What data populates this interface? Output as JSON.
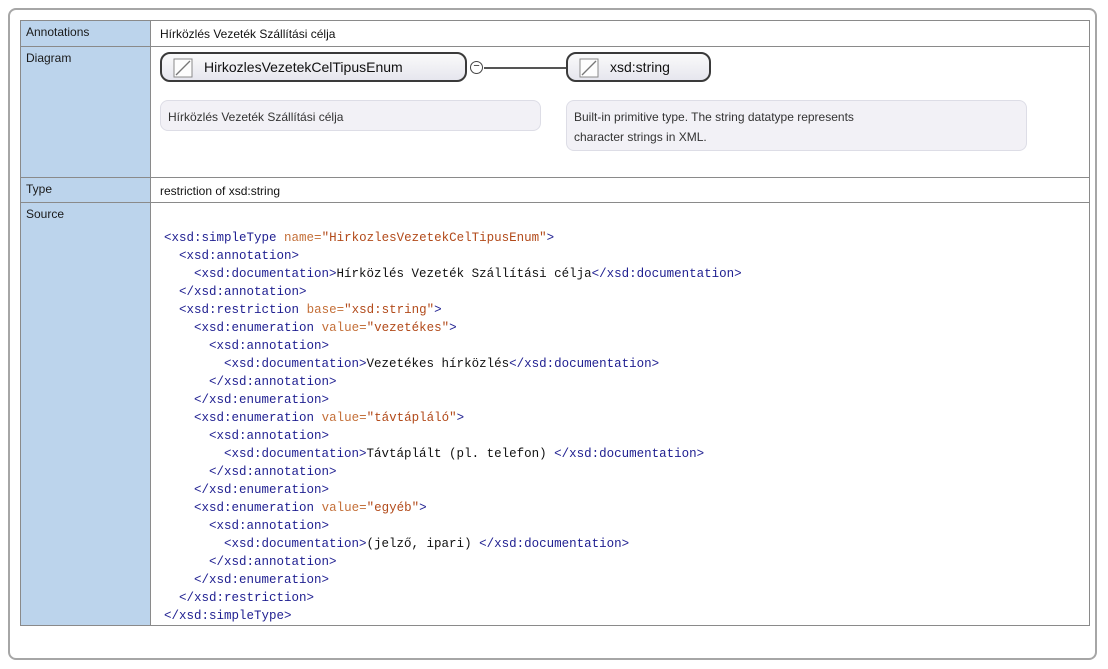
{
  "labels": {
    "annotations": "Annotations",
    "diagram": "Diagram",
    "type": "Type",
    "source": "Source"
  },
  "annotation_text": "Hírközlés Vezeték Szállítási célja",
  "diagram": {
    "main_node": "HirkozlesVezetekCelTipusEnum",
    "main_doc": "Hírközlés Vezeték Szállítási célja",
    "base_node": "xsd:string",
    "base_doc_line1": "Built-in primitive type. The string datatype represents",
    "base_doc_line2": "character strings in XML."
  },
  "type_text": "restriction of xsd:string",
  "source": {
    "simple_type_open": "<xsd:simpleType",
    "name_attr": "name=",
    "name_value": "\"HirkozlesVezetekCelTipusEnum\"",
    "gt": ">",
    "annotation_open": "<xsd:annotation>",
    "annotation_close": "</xsd:annotation>",
    "documentation_open": "<xsd:documentation>",
    "documentation_close": "</xsd:documentation>",
    "main_doc": "Hírközlés Vezeték Szállítási célja",
    "restriction_open": "<xsd:restriction",
    "base_attr": "base=",
    "base_value": "\"xsd:string\"",
    "restriction_close": "</xsd:restriction>",
    "enumeration_open": "<xsd:enumeration",
    "enumeration_close": "</xsd:enumeration>",
    "value_attr": "value=",
    "simple_type_close": "</xsd:simpleType>",
    "enumerations": [
      {
        "value": "\"vezetékes\"",
        "doc": "Vezetékes hírközlés"
      },
      {
        "value": "\"távtápláló\"",
        "doc": "Távtáplált (pl. telefon) "
      },
      {
        "value": "\"egyéb\"",
        "doc": "(jelző, ipari) "
      }
    ]
  }
}
